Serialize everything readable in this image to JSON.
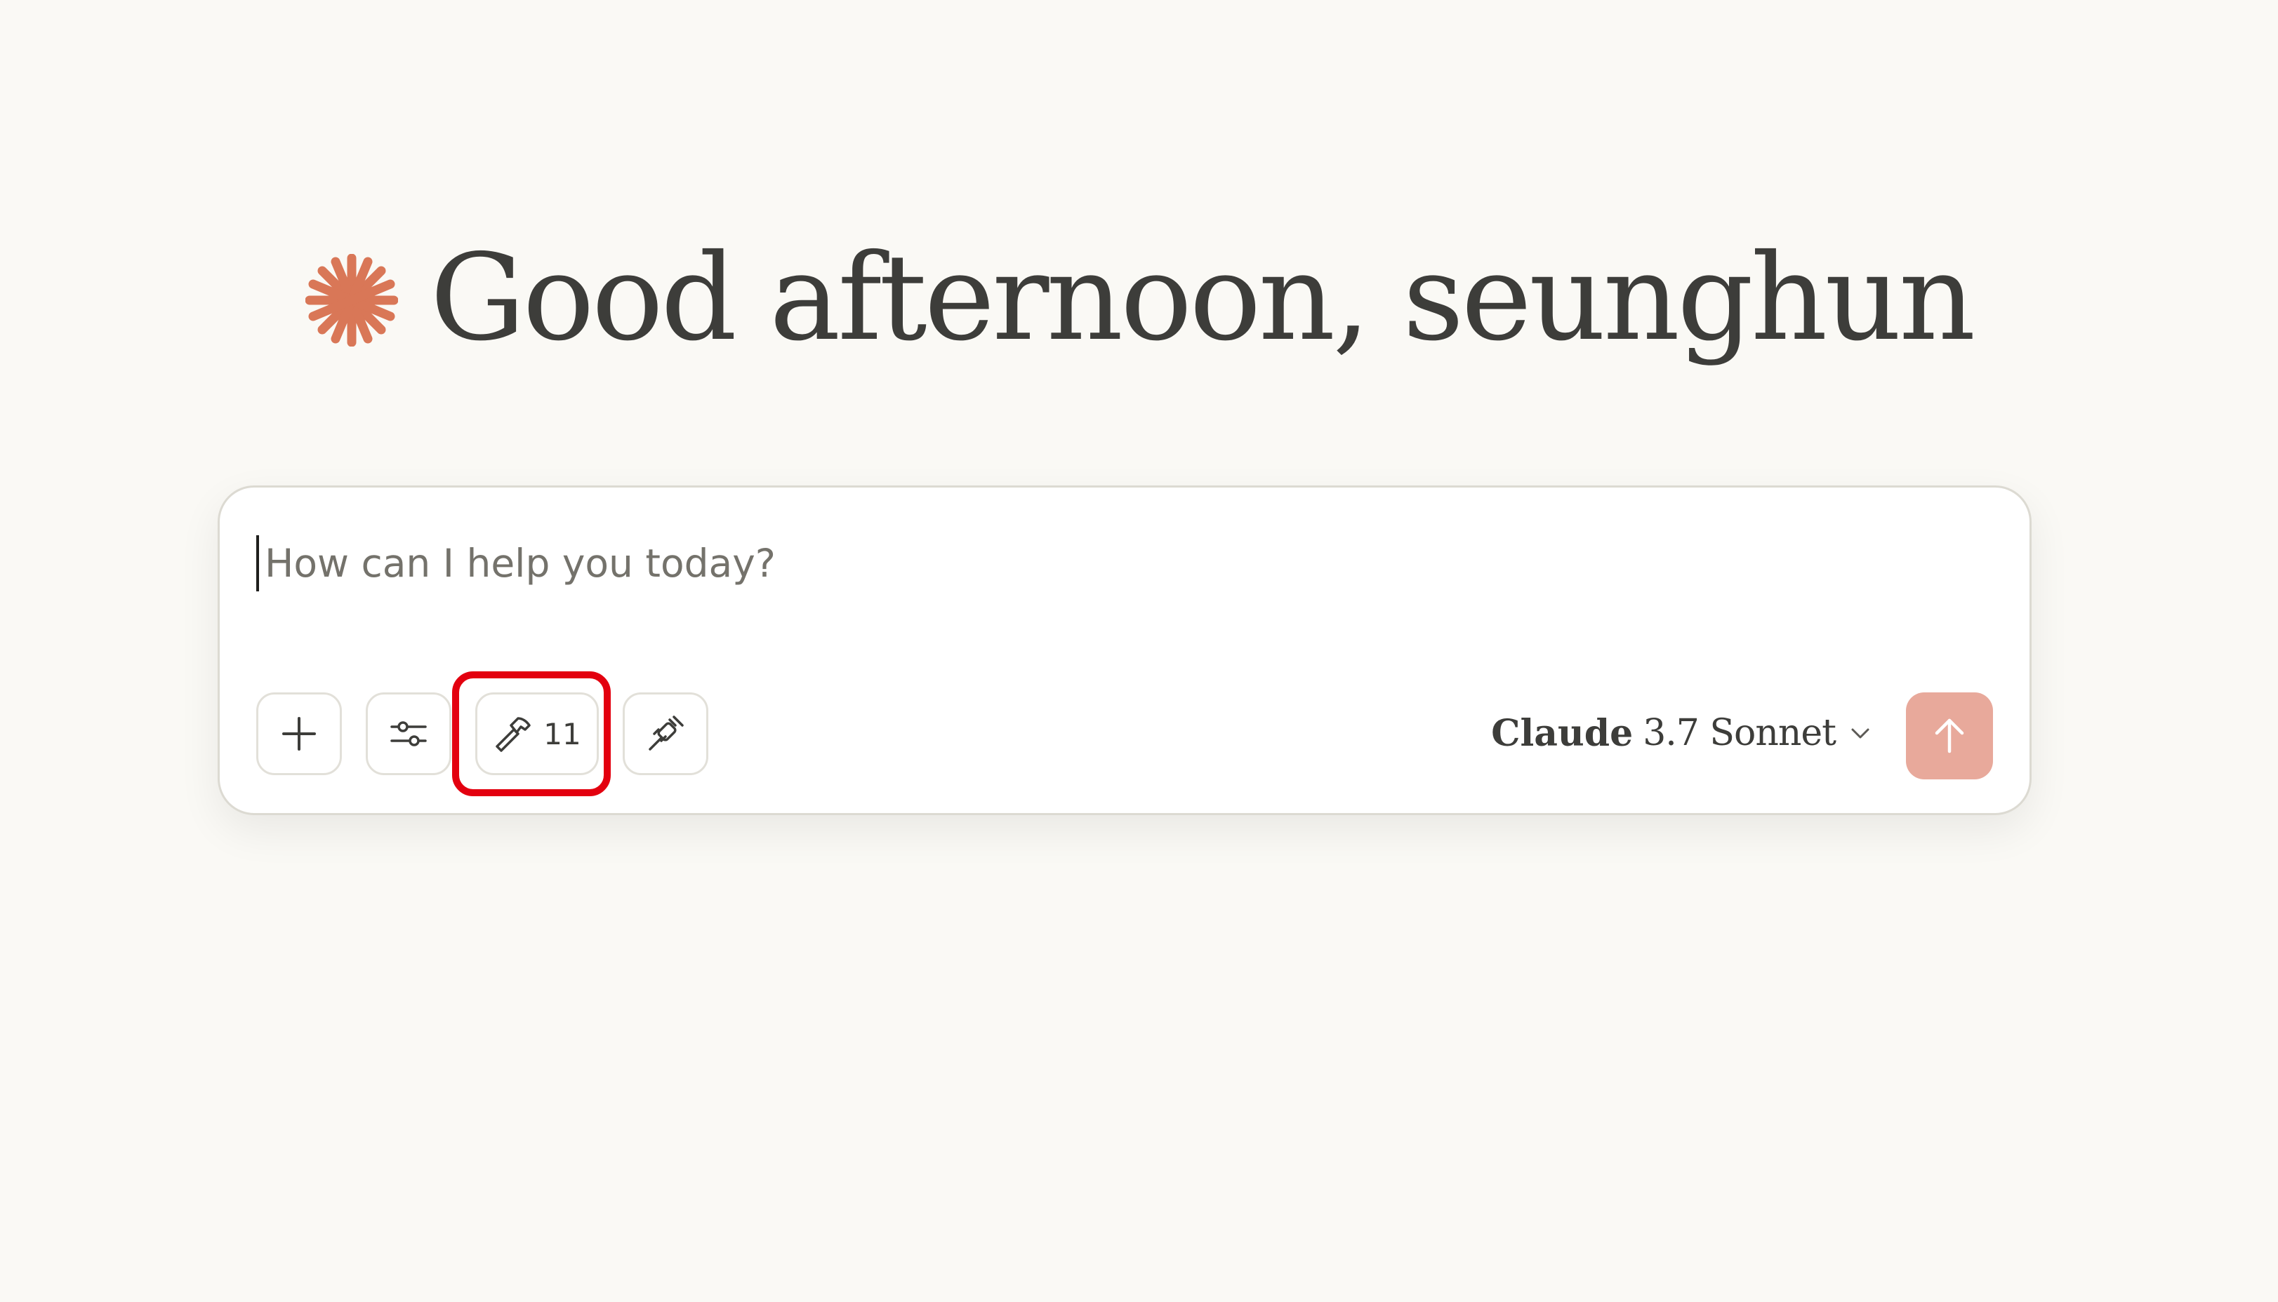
{
  "greeting": {
    "text": "Good afternoon, seunghun",
    "icon": "spark-icon"
  },
  "composer": {
    "placeholder": "How can I help you today?",
    "value": "",
    "buttons": {
      "add": {
        "icon": "plus-icon"
      },
      "options": {
        "icon": "sliders-icon"
      },
      "tools": {
        "icon": "hammer-icon",
        "count": "11",
        "highlighted": true
      },
      "connect": {
        "icon": "plug-icon"
      }
    },
    "model": {
      "name": "Claude",
      "version": "3.7 Sonnet",
      "icon": "chevron-down-icon"
    },
    "send": {
      "icon": "arrow-up-icon"
    }
  },
  "colors": {
    "background": "#faf9f5",
    "accent": "#d97757",
    "send_button": "#e8a99b",
    "highlight": "#e3000f",
    "text": "#3d3d3a"
  }
}
